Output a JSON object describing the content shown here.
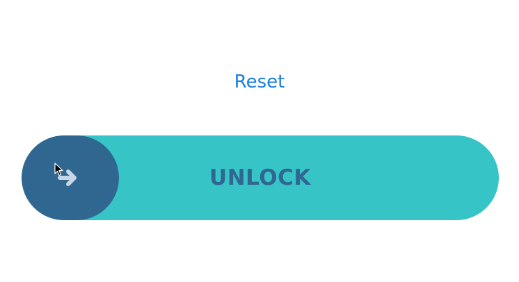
{
  "reset": {
    "label": "Reset",
    "color": "#1a7ee0"
  },
  "slider": {
    "label": "UNLOCK",
    "track_color": "#37c4c7",
    "handle_color": "#2f6790",
    "label_color": "#2f6790",
    "icon": "arrow-right-icon",
    "icon_color": "#c7d6e4",
    "progress": 0
  }
}
